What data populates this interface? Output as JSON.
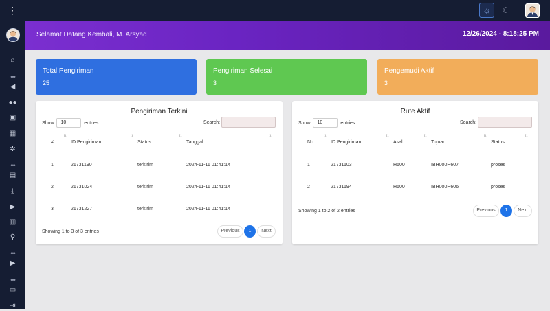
{
  "topbar": {
    "menu_icon": "kebab-menu-icon",
    "sun_icon": "sun-icon",
    "moon_icon": "moon-icon"
  },
  "header": {
    "welcome": "Selamat Datang Kembali, M. Arsyad",
    "datetime": "12/26/2024 - 8:18:25 PM"
  },
  "stats": [
    {
      "label": "Total Pengiriman",
      "value": "25",
      "color": "#2f6fe0"
    },
    {
      "label": "Pengiriman Selesai",
      "value": "3",
      "color": "#5fc851"
    },
    {
      "label": "Pengemudi Aktif",
      "value": "3",
      "color": "#f2ad5a"
    }
  ],
  "recent": {
    "title": "Pengiriman Terkini",
    "show_label": "Show",
    "length": "10",
    "entries_label": "entries",
    "search_label": "Search:",
    "columns": [
      "#",
      "ID Pengiriman",
      "Status",
      "Tanggal"
    ],
    "rows": [
      [
        "1",
        "21731190",
        "terkirim",
        "2024-11-11 01:41:14"
      ],
      [
        "2",
        "21731024",
        "terkirim",
        "2024-11-11 01:41:14"
      ],
      [
        "3",
        "21731227",
        "terkirim",
        "2024-11-11 01:41:14"
      ]
    ],
    "info": "Showing 1 to 3 of 3 entries",
    "prev": "Previous",
    "page": "1",
    "next": "Next"
  },
  "routes": {
    "title": "Rute Aktif",
    "show_label": "Show",
    "length": "10",
    "entries_label": "entries",
    "search_label": "Search:",
    "columns": [
      "No.",
      "ID Pengiriman",
      "Asal",
      "Tujuan",
      "Status"
    ],
    "rows": [
      [
        "1",
        "21731103",
        "H600",
        "IBH000H607",
        "proses"
      ],
      [
        "2",
        "21731194",
        "H600",
        "IBH000H606",
        "proses"
      ]
    ],
    "info": "Showing 1 to 2 of 2 entries",
    "prev": "Previous",
    "page": "1",
    "next": "Next"
  },
  "sidebar_icons": [
    "home-icon",
    "megaphone-icon",
    "users-icon",
    "money-icon",
    "calendar-icon",
    "gears-icon",
    "document-icon",
    "download-icon",
    "truck-icon",
    "group-icon",
    "motorcycle-icon",
    "truck-icon",
    "inbox-icon",
    "logout-icon"
  ]
}
